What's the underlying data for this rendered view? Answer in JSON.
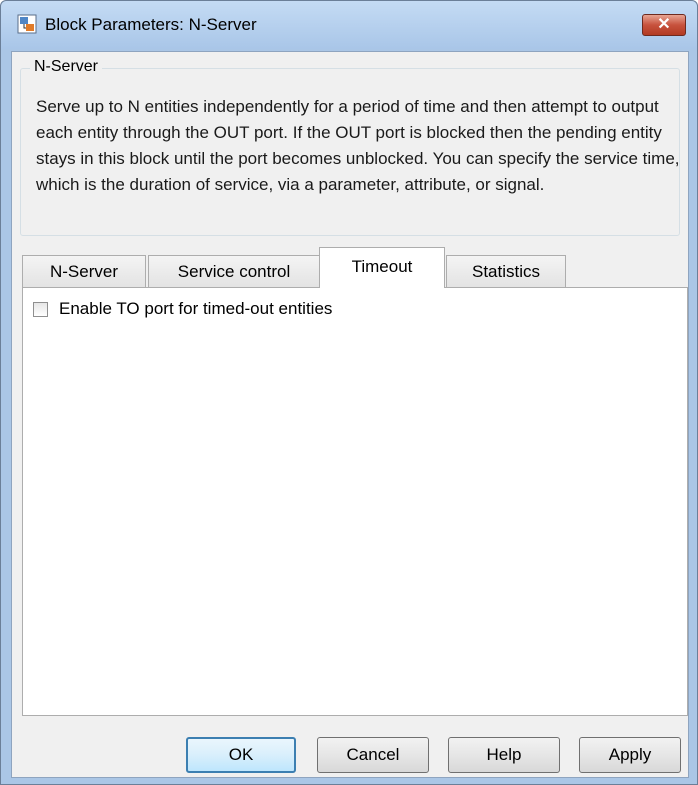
{
  "window": {
    "title": "Block Parameters: N-Server",
    "close_glyph": "✕",
    "icon": "simulink-block-icon"
  },
  "group": {
    "legend": "N-Server",
    "description": "Serve up to N entities independently for a period of time and then attempt to output each entity through the OUT port. If the OUT port is blocked then the pending entity stays in this block until the port becomes unblocked. You can specify the service time, which is the duration of service, via a parameter, attribute, or signal."
  },
  "tabs": [
    {
      "label": "N-Server",
      "active": false
    },
    {
      "label": "Service control",
      "active": false
    },
    {
      "label": "Timeout",
      "active": true
    },
    {
      "label": "Statistics",
      "active": false
    }
  ],
  "timeout_panel": {
    "enable_to_port_label": "Enable TO port for timed-out entities",
    "enable_to_port_checked": false
  },
  "buttons": {
    "ok": "OK",
    "cancel": "Cancel",
    "help": "Help",
    "apply": "Apply"
  },
  "colors": {
    "frame": "#aac6e6",
    "close_button": "#c7523d",
    "default_button_border": "#3c7fb1"
  }
}
